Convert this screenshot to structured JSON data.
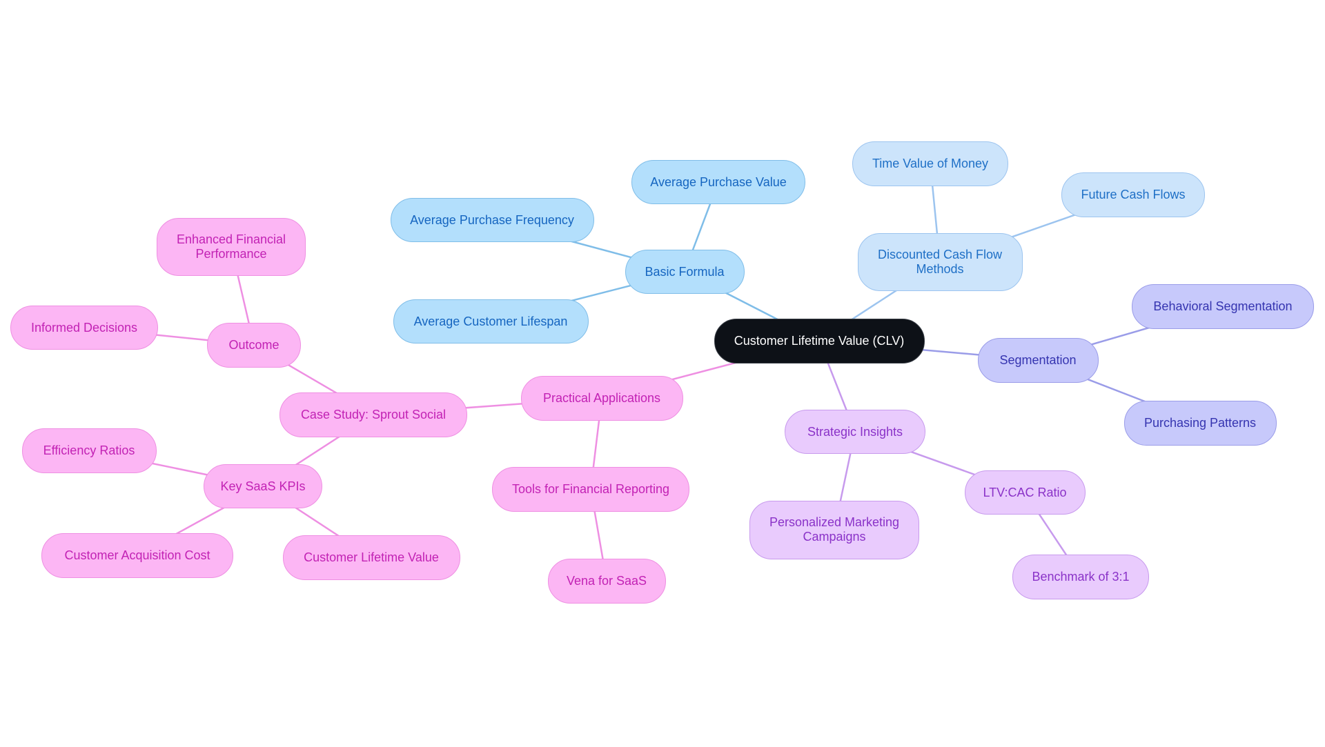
{
  "title": "Customer Lifetime Value (CLV)",
  "palette": {
    "root": "#0d1117",
    "blue": "#7fbde8",
    "lightblue": "#9cc4ef",
    "indigo": "#9a9ce8",
    "lavender": "#c79aed",
    "pink": "#ee8fe2"
  },
  "nodes": [
    {
      "id": "clv",
      "label": "Customer Lifetime Value (CLV)",
      "style": "root",
      "parent": null
    },
    {
      "id": "basic-formula",
      "label": "Basic Formula",
      "style": "blue",
      "parent": "clv"
    },
    {
      "id": "avg-purchase-value",
      "label": "Average Purchase Value",
      "style": "blue",
      "parent": "basic-formula"
    },
    {
      "id": "avg-purchase-frequency",
      "label": "Average Purchase Frequency",
      "style": "blue",
      "parent": "basic-formula"
    },
    {
      "id": "avg-customer-lifespan",
      "label": "Average Customer Lifespan",
      "style": "blue",
      "parent": "basic-formula"
    },
    {
      "id": "dcf-methods",
      "label": "Discounted Cash Flow\nMethods",
      "style": "lightblue",
      "parent": "clv"
    },
    {
      "id": "time-value-of-money",
      "label": "Time Value of Money",
      "style": "lightblue",
      "parent": "dcf-methods"
    },
    {
      "id": "future-cash-flows",
      "label": "Future Cash Flows",
      "style": "lightblue",
      "parent": "dcf-methods"
    },
    {
      "id": "segmentation",
      "label": "Segmentation",
      "style": "indigo",
      "parent": "clv"
    },
    {
      "id": "behavioral-segmentation",
      "label": "Behavioral Segmentation",
      "style": "indigo",
      "parent": "segmentation"
    },
    {
      "id": "purchasing-patterns",
      "label": "Purchasing Patterns",
      "style": "indigo",
      "parent": "segmentation"
    },
    {
      "id": "strategic-insights",
      "label": "Strategic Insights",
      "style": "lavender",
      "parent": "clv"
    },
    {
      "id": "personalized-marketing",
      "label": "Personalized Marketing\nCampaigns",
      "style": "lavender",
      "parent": "strategic-insights"
    },
    {
      "id": "ltv-cac-ratio",
      "label": "LTV:CAC Ratio",
      "style": "lavender",
      "parent": "strategic-insights"
    },
    {
      "id": "benchmark-3-1",
      "label": "Benchmark of 3:1",
      "style": "lavender",
      "parent": "ltv-cac-ratio"
    },
    {
      "id": "practical-applications",
      "label": "Practical Applications",
      "style": "pink",
      "parent": "clv"
    },
    {
      "id": "tools-financial-reporting",
      "label": "Tools for Financial Reporting",
      "style": "pink",
      "parent": "practical-applications"
    },
    {
      "id": "vena-for-saas",
      "label": "Vena for SaaS",
      "style": "pink",
      "parent": "tools-financial-reporting"
    },
    {
      "id": "case-study-sprout",
      "label": "Case Study: Sprout Social",
      "style": "pink",
      "parent": "practical-applications"
    },
    {
      "id": "outcome",
      "label": "Outcome",
      "style": "pink",
      "parent": "case-study-sprout"
    },
    {
      "id": "enhanced-financial-performance",
      "label": "Enhanced Financial\nPerformance",
      "style": "pink",
      "parent": "outcome"
    },
    {
      "id": "informed-decisions",
      "label": "Informed Decisions",
      "style": "pink",
      "parent": "outcome"
    },
    {
      "id": "key-saas-kpis",
      "label": "Key SaaS KPIs",
      "style": "pink",
      "parent": "case-study-sprout"
    },
    {
      "id": "efficiency-ratios",
      "label": "Efficiency Ratios",
      "style": "pink",
      "parent": "key-saas-kpis"
    },
    {
      "id": "customer-acquisition-cost",
      "label": "Customer Acquisition Cost",
      "style": "pink",
      "parent": "key-saas-kpis"
    },
    {
      "id": "customer-lifetime-value",
      "label": "Customer Lifetime Value",
      "style": "pink",
      "parent": "key-saas-kpis"
    }
  ]
}
